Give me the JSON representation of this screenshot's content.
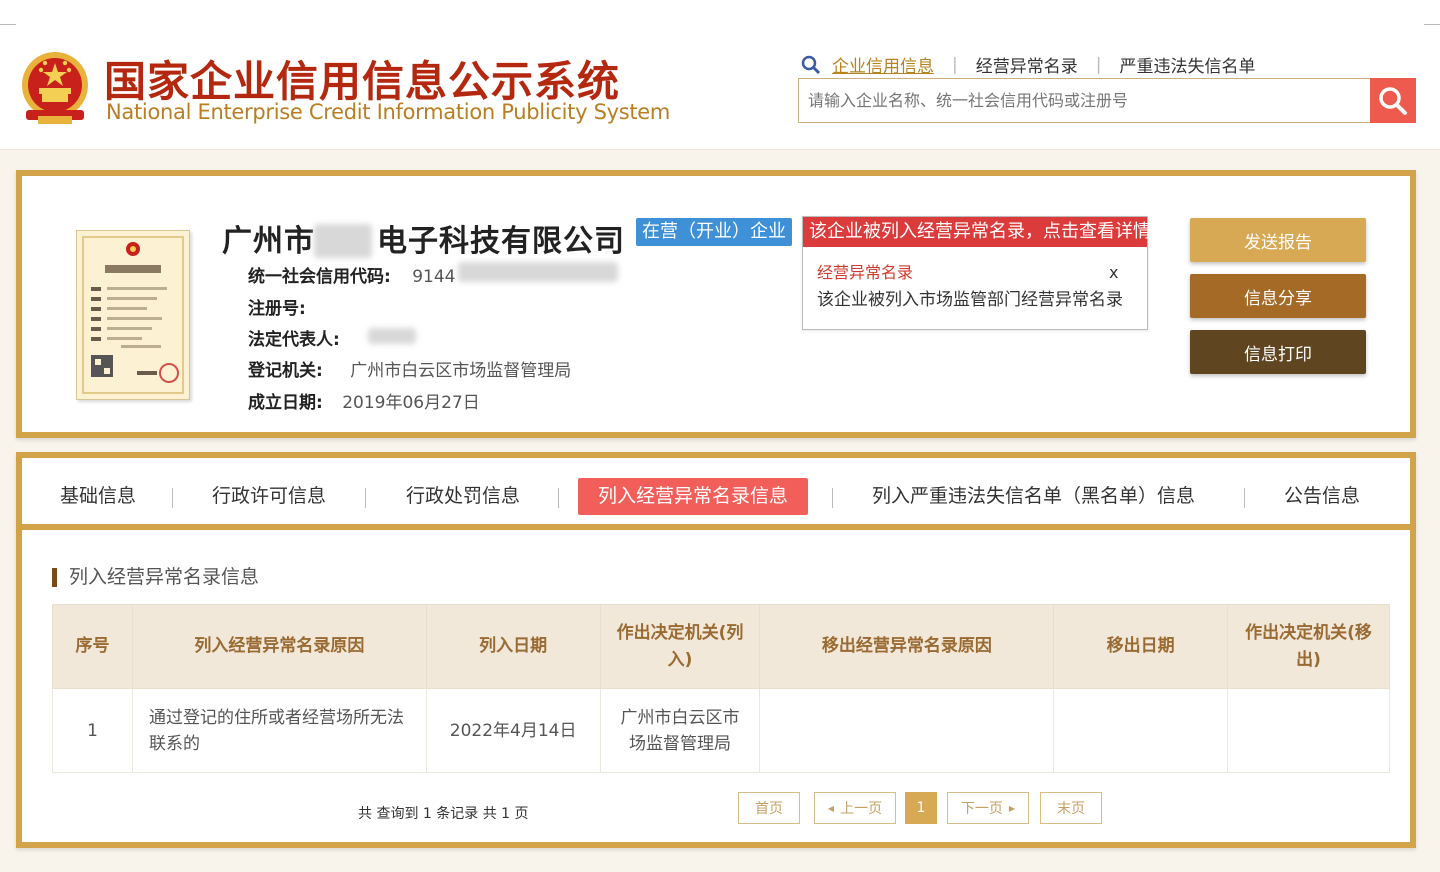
{
  "header": {
    "title_cn": "国家企业信用信息公示系统",
    "title_en": "National Enterprise Credit Information Publicity System",
    "links": [
      "企业信用信息",
      "经营异常名录",
      "严重违法失信名单"
    ],
    "search_placeholder": "请输入企业名称、统一社会信用代码或注册号"
  },
  "company": {
    "name_prefix": "广州市",
    "name_suffix": "电子科技有限公司",
    "status": "在营（开业）企业",
    "credit_code_label": "统一社会信用代码:",
    "credit_code_value": "9144",
    "reg_no_label": "注册号:",
    "legal_rep_label": "法定代表人:",
    "authority_label": "登记机关:",
    "authority_value": "广州市白云区市场监督管理局",
    "founded_label": "成立日期:",
    "founded_value": "2019年06月27日"
  },
  "abnormal_notice": {
    "head": "该企业被列入经营异常名录，点击查看详情",
    "sub": "经营异常名录",
    "close": "x",
    "desc": "该企业被列入市场监管部门经营异常名录"
  },
  "actions": [
    "发送报告",
    "信息分享",
    "信息打印"
  ],
  "tabs": [
    "基础信息",
    "行政许可信息",
    "行政处罚信息",
    "列入经营异常名录信息",
    "列入严重违法失信名单（黑名单）信息",
    "公告信息"
  ],
  "section": {
    "title": "列入经营异常名录信息",
    "columns": [
      "序号",
      "列入经营异常名录原因",
      "列入日期",
      "作出决定机关(列入)",
      "移出经营异常名录原因",
      "移出日期",
      "作出决定机关(移出)"
    ],
    "rows": [
      [
        "1",
        "通过登记的住所或者经营场所无法联系的",
        "2022年4月14日",
        "广州市白云区市场监督管理局",
        "",
        "",
        ""
      ]
    ]
  },
  "pager": {
    "info": "共 查询到 1 条记录 共 1 页",
    "first": "首页",
    "prev": "上一页",
    "current": "1",
    "next": "下一页",
    "last": "末页"
  },
  "colors": {
    "gold": "#d3a34a",
    "red": "#f25e5a",
    "blue": "#3e90d7"
  }
}
